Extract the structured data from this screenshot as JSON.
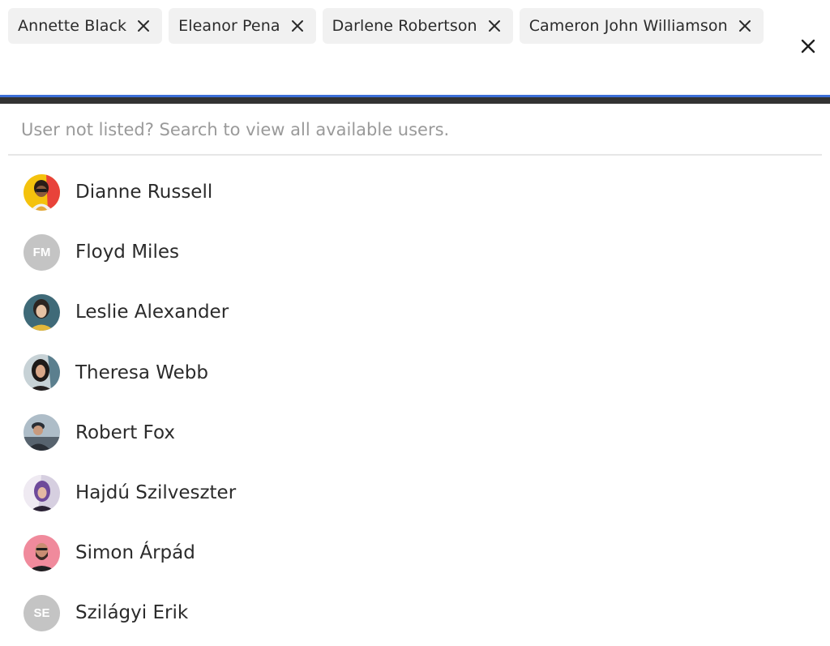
{
  "selected_chips": [
    {
      "label": "Annette Black"
    },
    {
      "label": "Eleanor Pena"
    },
    {
      "label": "Darlene Robertson"
    },
    {
      "label": "Cameron John Williamson"
    }
  ],
  "hint_text": "User not listed? Search to view all available users.",
  "users": [
    {
      "name": "Dianne Russell",
      "avatar": "photo"
    },
    {
      "name": "Floyd Miles",
      "avatar": "initials",
      "initials": "FM"
    },
    {
      "name": "Leslie Alexander",
      "avatar": "photo"
    },
    {
      "name": "Theresa Webb",
      "avatar": "photo"
    },
    {
      "name": "Robert Fox",
      "avatar": "photo"
    },
    {
      "name": "Hajdú Szilveszter",
      "avatar": "photo"
    },
    {
      "name": "Simon Árpád",
      "avatar": "photo"
    },
    {
      "name": "Szilágyi Erik",
      "avatar": "initials",
      "initials": "SE"
    }
  ],
  "colors": {
    "focus_border": "#3d6fd8",
    "chip_bg": "#f1f1f1",
    "initials_bg": "#c4c4c4"
  },
  "icons": {
    "chip_remove": "close-icon",
    "clear_all": "close-icon"
  }
}
